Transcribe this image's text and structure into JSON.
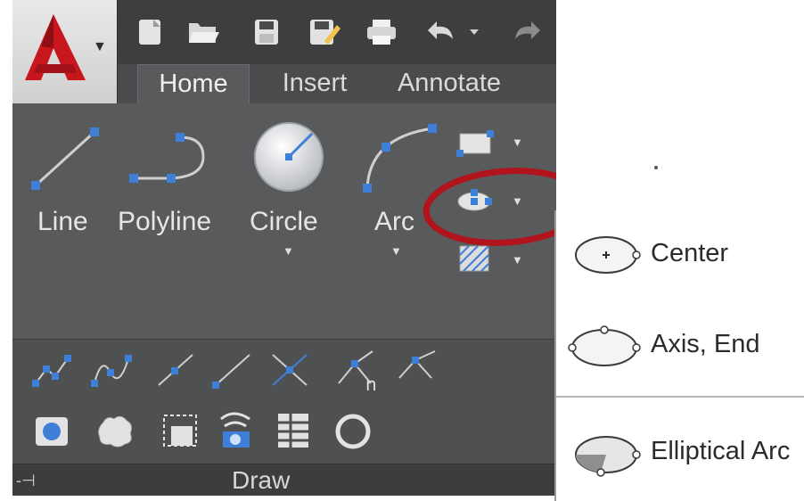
{
  "tabs": [
    {
      "label": "Home",
      "active": true
    },
    {
      "label": "Insert",
      "active": false
    },
    {
      "label": "Annotate",
      "active": false
    }
  ],
  "draw_tools": {
    "line": "Line",
    "polyline": "Polyline",
    "circle": "Circle",
    "arc": "Arc"
  },
  "panel": {
    "title": "Draw"
  },
  "ellipse_menu": {
    "items": [
      {
        "label": "Center",
        "icon": "ellipse-center-icon"
      },
      {
        "label": "Axis, End",
        "icon": "ellipse-axis-end-icon"
      },
      {
        "label": "Elliptical Arc",
        "icon": "elliptical-arc-icon"
      }
    ]
  },
  "colors": {
    "ribbon_bg": "#595a5c",
    "highlight_ring": "#b1141b",
    "grip_blue": "#3f7fd8",
    "logo_red": "#c8161d"
  }
}
